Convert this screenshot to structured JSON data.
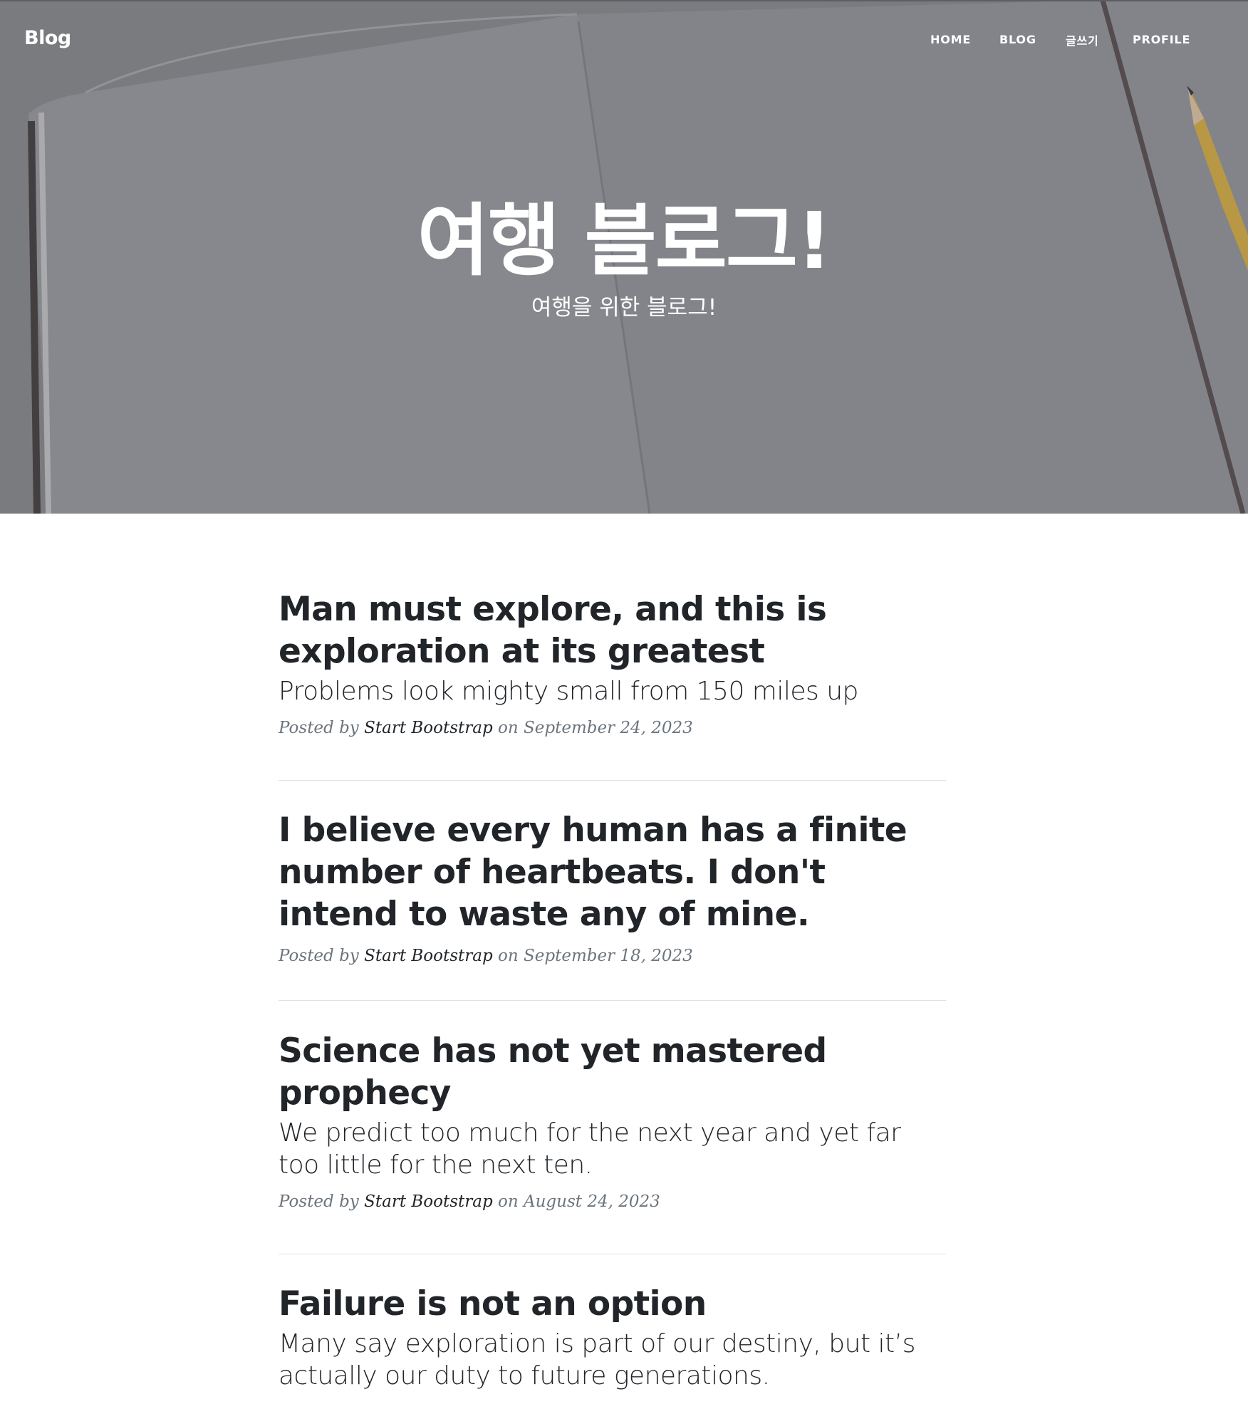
{
  "nav": {
    "brand": "Blog",
    "items": [
      {
        "label": "HOME"
      },
      {
        "label": "BLOG"
      },
      {
        "label": "글쓰기"
      },
      {
        "label": "PROFILE"
      }
    ]
  },
  "hero": {
    "title": "여행 블로그!",
    "subtitle": "여행을 위한 블로그!"
  },
  "meta_words": {
    "posted_by": "Posted by",
    "on": "on"
  },
  "posts": [
    {
      "title": "Man must explore, and this is exploration at its greatest",
      "subtitle": "Problems look mighty small from 150 miles up",
      "author": "Start Bootstrap",
      "date": "September 24, 2023"
    },
    {
      "title": "I believe every human has a finite number of heartbeats. I don't intend to waste any of mine.",
      "subtitle": "",
      "author": "Start Bootstrap",
      "date": "September 18, 2023"
    },
    {
      "title": "Science has not yet mastered prophecy",
      "subtitle": "We predict too much for the next year and yet far too little for the next ten.",
      "author": "Start Bootstrap",
      "date": "August 24, 2023"
    },
    {
      "title": "Failure is not an option",
      "subtitle": "Many say exploration is part of our destiny, but it’s actually our duty to future generations.",
      "author": "",
      "date": ""
    }
  ]
}
